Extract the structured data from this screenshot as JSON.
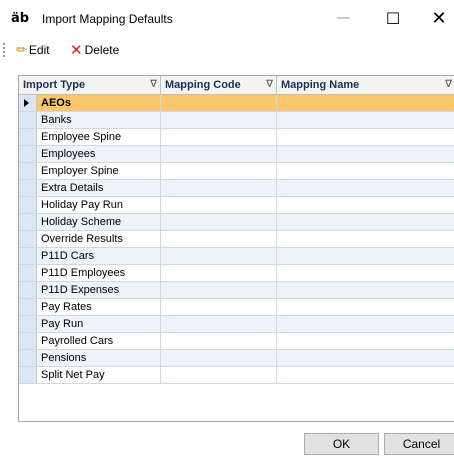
{
  "window": {
    "app_icon": "äb",
    "title": "Import Mapping Defaults",
    "minimize": "—",
    "maximize": "☐",
    "close": "✕"
  },
  "toolbar": {
    "edit_label": "Edit",
    "delete_label": "Delete",
    "edit_icon": "pencil-icon",
    "delete_icon": "red-x-icon"
  },
  "grid": {
    "columns": [
      "Import Type",
      "Mapping Code",
      "Mapping Name"
    ],
    "filter_symbol": "∇",
    "rows": [
      {
        "import_type": "AEOs",
        "mapping_code": "",
        "mapping_name": ""
      },
      {
        "import_type": "Banks",
        "mapping_code": "",
        "mapping_name": ""
      },
      {
        "import_type": "Employee Spine",
        "mapping_code": "",
        "mapping_name": ""
      },
      {
        "import_type": "Employees",
        "mapping_code": "",
        "mapping_name": ""
      },
      {
        "import_type": "Employer Spine",
        "mapping_code": "",
        "mapping_name": ""
      },
      {
        "import_type": "Extra Details",
        "mapping_code": "",
        "mapping_name": ""
      },
      {
        "import_type": "Holiday Pay Run",
        "mapping_code": "",
        "mapping_name": ""
      },
      {
        "import_type": "Holiday Scheme",
        "mapping_code": "",
        "mapping_name": ""
      },
      {
        "import_type": "Override Results",
        "mapping_code": "",
        "mapping_name": ""
      },
      {
        "import_type": "P11D Cars",
        "mapping_code": "",
        "mapping_name": ""
      },
      {
        "import_type": "P11D Employees",
        "mapping_code": "",
        "mapping_name": ""
      },
      {
        "import_type": "P11D Expenses",
        "mapping_code": "",
        "mapping_name": ""
      },
      {
        "import_type": "Pay Rates",
        "mapping_code": "",
        "mapping_name": ""
      },
      {
        "import_type": "Pay Run",
        "mapping_code": "",
        "mapping_name": ""
      },
      {
        "import_type": "Payrolled Cars",
        "mapping_code": "",
        "mapping_name": ""
      },
      {
        "import_type": "Pensions",
        "mapping_code": "",
        "mapping_name": ""
      },
      {
        "import_type": "Split Net Pay",
        "mapping_code": "",
        "mapping_name": ""
      }
    ],
    "selected_index": 0,
    "selected_color": "#fbc76a",
    "alt_row_color": "#edf3fb"
  },
  "buttons": {
    "ok": "OK",
    "cancel": "Cancel"
  }
}
